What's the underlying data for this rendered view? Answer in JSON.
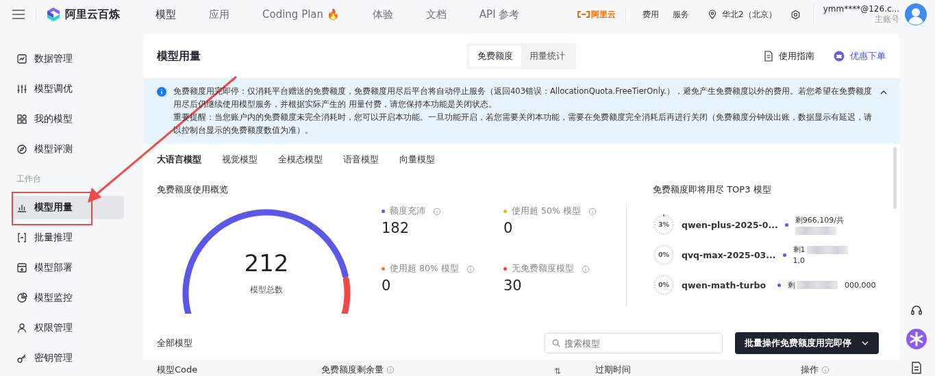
{
  "topbar": {
    "brand": "阿里云百炼",
    "nav": [
      {
        "label": "模型",
        "selected": true
      },
      {
        "label": "应用",
        "selected": false
      },
      {
        "label": "Coding Plan",
        "selected": false,
        "emoji": "🔥"
      },
      {
        "label": "体验",
        "selected": false
      },
      {
        "label": "文档",
        "selected": false
      },
      {
        "label": "API 参考",
        "selected": false
      }
    ],
    "cloud_logo": "阿里云",
    "links": [
      "费用",
      "服务"
    ],
    "region": "华北2（北京）",
    "account": {
      "email": "ymm****@126.c...",
      "role": "主账号"
    }
  },
  "sidebar": {
    "items": [
      {
        "label": "数据管理",
        "selected": false
      },
      {
        "label": "模型调优",
        "selected": false
      },
      {
        "label": "我的模型",
        "selected": false
      },
      {
        "label": "模型评测",
        "selected": false
      },
      {
        "label": "模型用量",
        "selected": true,
        "group": "工作台"
      },
      {
        "label": "批量推理",
        "selected": false
      },
      {
        "label": "模型部署",
        "selected": false
      },
      {
        "label": "模型监控",
        "selected": false
      },
      {
        "label": "权限管理",
        "selected": false
      },
      {
        "label": "密钥管理",
        "selected": false
      }
    ]
  },
  "page": {
    "title": "模型用量",
    "segments": [
      {
        "label": "免费额度",
        "selected": true
      },
      {
        "label": "用量统计",
        "selected": false
      }
    ],
    "guide": "使用指南",
    "order": "优惠下单"
  },
  "notice": {
    "expanded": true,
    "paragraphs": [
      "免费额度用完即停：仅消耗平台赠送的免费额度，免费额度用尽后平台将自动停止服务（返回403错误：AllocationQuota.FreeTierOnly.），避免产生免费额度以外的费用。若您希望在免费额度用尽后仍继续使用模型服务，并根据实际产生的 用量付费，请您保持本功能是关闭状态。",
      "重要提醒：当您账户内的免费额度未完全消耗时，您可以开启本功能。一旦功能开启，若您需要关闭本功能，需要在免费额度完全消耗后再进行关闭（免费额度分钟级出账，数据显示有延迟，请以控制台显示的免费额度数值为准）。"
    ]
  },
  "model_tabs": [
    {
      "label": "大语言模型",
      "selected": true
    },
    {
      "label": "视觉模型",
      "selected": false
    },
    {
      "label": "全模态模型",
      "selected": false
    },
    {
      "label": "语音模型",
      "selected": false
    },
    {
      "label": "向量模型",
      "selected": false
    }
  ],
  "overview": {
    "title": "免费额度使用概览",
    "total": "212",
    "total_label": "模型总数",
    "stats": [
      {
        "label": "额度充沛",
        "value": "182",
        "color": "#5b57e8"
      },
      {
        "label": "使用超 50% 模型",
        "value": "0",
        "color": "#f5b800"
      },
      {
        "label": "使用超 80% 模型",
        "value": "0",
        "color": "#f77b2a"
      },
      {
        "label": "无免费额度模型",
        "value": "30",
        "color": "#f04848"
      }
    ]
  },
  "top3": {
    "title": "免费额度即将用尽 TOP3 模型",
    "items": [
      {
        "percent": "3%",
        "name": "qwen-plus-2025-0...",
        "remaining": "剩966,109/共"
      },
      {
        "percent": "0%",
        "name": "qvq-max-2025-03...",
        "remaining": "剩1",
        "remaining_end": "1,0"
      },
      {
        "percent": "0%",
        "name": "qwen-math-turbo",
        "remaining": "剩",
        "remaining_end": "000,000"
      }
    ]
  },
  "models": {
    "title": "全部模型",
    "search": {
      "placeholder": "搜索模型"
    },
    "batch_button": "批量操作免费额度用完即停",
    "columns": [
      {
        "label": "模型Code",
        "kind": "text",
        "info": false
      },
      {
        "label": "免费额度剩余量",
        "kind": "text",
        "info": true
      },
      {
        "label": "⇅",
        "kind": "sort",
        "info": false
      },
      {
        "label": "过期时间",
        "kind": "text",
        "info": false
      },
      {
        "label": "操作",
        "kind": "text",
        "info": true
      }
    ]
  }
}
